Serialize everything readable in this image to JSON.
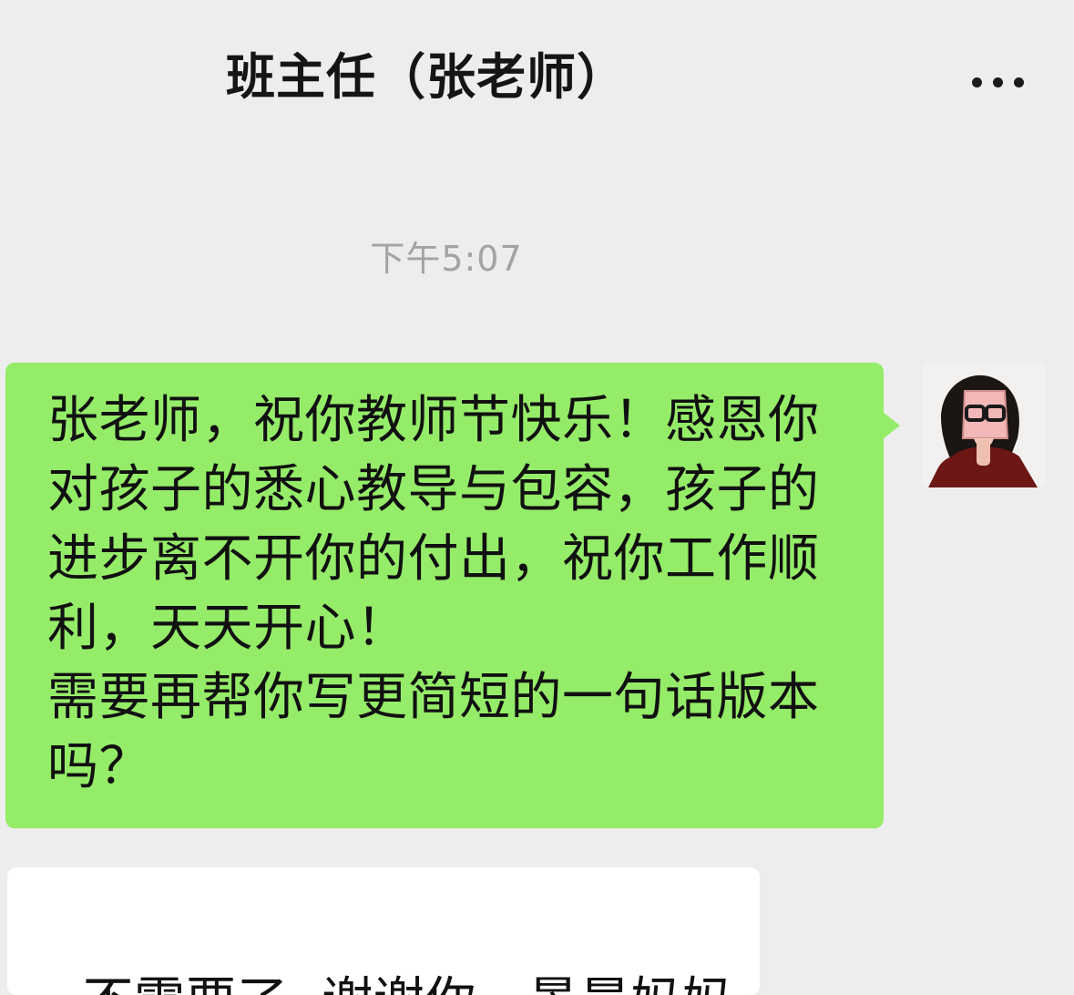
{
  "header": {
    "title": "班主任（张老师）",
    "more_icon": "more-horizontal-icon"
  },
  "chat": {
    "timestamp": "下午5:07",
    "messages": [
      {
        "direction": "outgoing",
        "lines": [
          "张老师，祝你教师节快乐！感恩你",
          "对孩子的悉心教导与包容，孩子的",
          "进步离不开你的付出，祝你工作顺",
          "利，天天开心！",
          "需要再帮你写更简短的一句话版本",
          "吗？"
        ]
      },
      {
        "direction": "incoming",
        "text": "不需要了  谢谢你，景晨妈妈"
      }
    ]
  },
  "colors": {
    "background": "#ededed",
    "outgoing_bubble": "#95ec69",
    "incoming_bubble": "#ffffff",
    "timestamp": "#a3a3a3"
  }
}
